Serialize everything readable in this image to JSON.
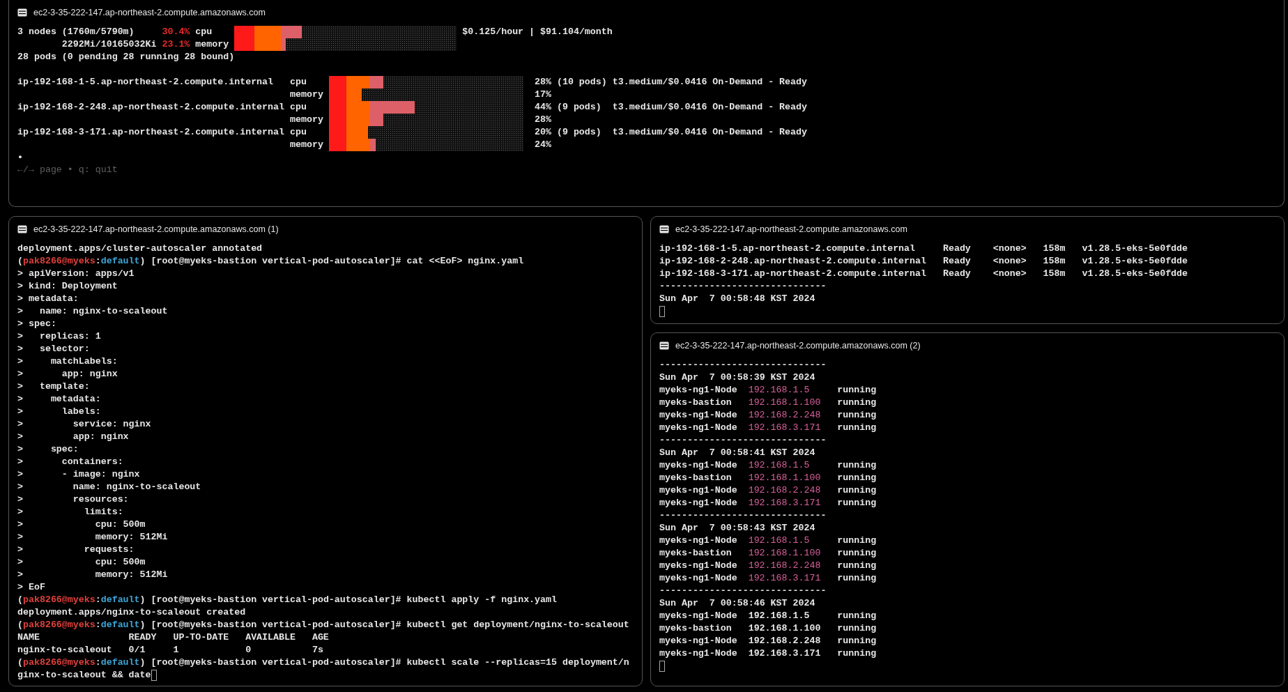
{
  "viewer": {
    "title": "ec2-3-35-222-147.ap-northeast-2.compute.amazonaws.com",
    "summary": [
      {
        "text": "3 nodes (1760m/5790m)",
        "percent": "30.4%",
        "resource": "cpu",
        "level": 0.304
      },
      {
        "text": "2292Mi/10165032Ki",
        "percent": "23.1%",
        "resource": "memory",
        "level": 0.231
      }
    ],
    "cost": "$0.125/hour | $91.104/month",
    "pods": "28 pods (0 pending 28 running 28 bound)",
    "nodes": [
      {
        "name": "ip-192-168-1-5.ap-northeast-2.compute.internal",
        "bars": [
          {
            "resource": "cpu",
            "level": 0.28,
            "percent": "28%"
          },
          {
            "resource": "memory",
            "level": 0.17,
            "percent": "17%"
          }
        ],
        "pods": "(10 pods)",
        "detail": "t3.medium/$0.0416 On-Demand - Ready"
      },
      {
        "name": "ip-192-168-2-248.ap-northeast-2.compute.internal",
        "bars": [
          {
            "resource": "cpu",
            "level": 0.44,
            "percent": "44%"
          },
          {
            "resource": "memory",
            "level": 0.28,
            "percent": "28%"
          }
        ],
        "pods": "(9 pods)",
        "detail": "t3.medium/$0.0416 On-Demand - Ready"
      },
      {
        "name": "ip-192-168-3-171.ap-northeast-2.compute.internal",
        "bars": [
          {
            "resource": "cpu",
            "level": 0.2,
            "percent": "20%"
          },
          {
            "resource": "memory",
            "level": 0.24,
            "percent": "24%"
          }
        ],
        "pods": "(9 pods)",
        "detail": "t3.medium/$0.0416 On-Demand - Ready"
      }
    ],
    "page_dot": "•",
    "help": "←/→ page • q: quit"
  },
  "shell": {
    "title": "ec2-3-35-222-147.ap-northeast-2.compute.amazonaws.com (1)",
    "lines": [
      {
        "text": "deployment.apps/cluster-autoscaler annotated"
      },
      {
        "segments": [
          {
            "kind": "plain",
            "text": "("
          },
          {
            "kind": "user",
            "text": "pak8266@myeks"
          },
          {
            "kind": "plain",
            "text": ":"
          },
          {
            "kind": "context",
            "text": "default"
          },
          {
            "kind": "plain",
            "text": ") [root@myeks-bastion vertical-pod-autoscaler]# cat <<EoF> nginx.yaml"
          }
        ]
      },
      {
        "text": "> apiVersion: apps/v1"
      },
      {
        "text": "> kind: Deployment"
      },
      {
        "text": "> metadata:"
      },
      {
        "text": ">   name: nginx-to-scaleout"
      },
      {
        "text": "> spec:"
      },
      {
        "text": ">   replicas: 1"
      },
      {
        "text": ">   selector:"
      },
      {
        "text": ">     matchLabels:"
      },
      {
        "text": ">       app: nginx"
      },
      {
        "text": ">   template:"
      },
      {
        "text": ">     metadata:"
      },
      {
        "text": ">       labels:"
      },
      {
        "text": ">         service: nginx"
      },
      {
        "text": ">         app: nginx"
      },
      {
        "text": ">     spec:"
      },
      {
        "text": ">       containers:"
      },
      {
        "text": ">       - image: nginx"
      },
      {
        "text": ">         name: nginx-to-scaleout"
      },
      {
        "text": ">         resources:"
      },
      {
        "text": ">           limits:"
      },
      {
        "text": ">             cpu: 500m"
      },
      {
        "text": ">             memory: 512Mi"
      },
      {
        "text": ">           requests:"
      },
      {
        "text": ">             cpu: 500m"
      },
      {
        "text": ">             memory: 512Mi"
      },
      {
        "text": "> EoF"
      },
      {
        "segments": [
          {
            "kind": "plain",
            "text": "("
          },
          {
            "kind": "user",
            "text": "pak8266@myeks"
          },
          {
            "kind": "plain",
            "text": ":"
          },
          {
            "kind": "context",
            "text": "default"
          },
          {
            "kind": "plain",
            "text": ") [root@myeks-bastion vertical-pod-autoscaler]# kubectl apply -f nginx.yaml"
          }
        ]
      },
      {
        "text": "deployment.apps/nginx-to-scaleout created"
      },
      {
        "segments": [
          {
            "kind": "plain",
            "text": "("
          },
          {
            "kind": "user",
            "text": "pak8266@myeks"
          },
          {
            "kind": "plain",
            "text": ":"
          },
          {
            "kind": "context",
            "text": "default"
          },
          {
            "kind": "plain",
            "text": ") [root@myeks-bastion vertical-pod-autoscaler]# kubectl get deployment/nginx-to-scaleout"
          }
        ]
      },
      {
        "text": "NAME                READY   UP-TO-DATE   AVAILABLE   AGE"
      },
      {
        "text": "nginx-to-scaleout   0/1     1            0           7s"
      },
      {
        "segments": [
          {
            "kind": "plain",
            "text": "("
          },
          {
            "kind": "user",
            "text": "pak8266@myeks"
          },
          {
            "kind": "plain",
            "text": ":"
          },
          {
            "kind": "context",
            "text": "default"
          },
          {
            "kind": "plain",
            "text": ") [root@myeks-bastion vertical-pod-autoscaler]# kubectl scale --replicas=15 deployment/n"
          }
        ]
      },
      {
        "text": "ginx-to-scaleout && date",
        "cursor": true
      }
    ]
  },
  "nodes_pane": {
    "title": "ec2-3-35-222-147.ap-northeast-2.compute.amazonaws.com",
    "lines": [
      {
        "text": "ip-192-168-1-5.ap-northeast-2.compute.internal     Ready    <none>   158m   v1.28.5-eks-5e0fdde"
      },
      {
        "text": "ip-192-168-2-248.ap-northeast-2.compute.internal   Ready    <none>   158m   v1.28.5-eks-5e0fdde"
      },
      {
        "text": "ip-192-168-3-171.ap-northeast-2.compute.internal   Ready    <none>   158m   v1.28.5-eks-5e0fdde"
      },
      {
        "text": "------------------------------"
      },
      {
        "text": "Sun Apr  7 00:58:48 KST 2024"
      },
      {
        "cursor": true
      }
    ]
  },
  "watch_pane": {
    "title": "ec2-3-35-222-147.ap-northeast-2.compute.amazonaws.com (2)",
    "blocks": [
      {
        "rule": "------------------------------",
        "timestamp": "Sun Apr  7 00:58:39 KST 2024",
        "highlight": true,
        "rows": [
          {
            "name": "myeks-ng1-Node",
            "ip": "192.168.1.5",
            "state": "running"
          },
          {
            "name": "myeks-bastion",
            "ip": "192.168.1.100",
            "state": "running"
          },
          {
            "name": "myeks-ng1-Node",
            "ip": "192.168.2.248",
            "state": "running"
          },
          {
            "name": "myeks-ng1-Node",
            "ip": "192.168.3.171",
            "state": "running"
          }
        ]
      },
      {
        "rule": "------------------------------",
        "timestamp": "Sun Apr  7 00:58:41 KST 2024",
        "highlight": true,
        "rows": [
          {
            "name": "myeks-ng1-Node",
            "ip": "192.168.1.5",
            "state": "running"
          },
          {
            "name": "myeks-bastion",
            "ip": "192.168.1.100",
            "state": "running"
          },
          {
            "name": "myeks-ng1-Node",
            "ip": "192.168.2.248",
            "state": "running"
          },
          {
            "name": "myeks-ng1-Node",
            "ip": "192.168.3.171",
            "state": "running"
          }
        ]
      },
      {
        "rule": "------------------------------",
        "timestamp": "Sun Apr  7 00:58:43 KST 2024",
        "highlight": true,
        "rows": [
          {
            "name": "myeks-ng1-Node",
            "ip": "192.168.1.5",
            "state": "running"
          },
          {
            "name": "myeks-bastion",
            "ip": "192.168.1.100",
            "state": "running"
          },
          {
            "name": "myeks-ng1-Node",
            "ip": "192.168.2.248",
            "state": "running"
          },
          {
            "name": "myeks-ng1-Node",
            "ip": "192.168.3.171",
            "state": "running"
          }
        ]
      },
      {
        "rule": "------------------------------",
        "timestamp": "Sun Apr  7 00:58:46 KST 2024",
        "highlight": false,
        "rows": [
          {
            "name": "myeks-ng1-Node",
            "ip": "192.168.1.5",
            "state": "running"
          },
          {
            "name": "myeks-bastion",
            "ip": "192.168.1.100",
            "state": "running"
          },
          {
            "name": "myeks-ng1-Node",
            "ip": "192.168.2.248",
            "state": "running"
          },
          {
            "name": "myeks-ng1-Node",
            "ip": "192.168.3.171",
            "state": "running"
          }
        ]
      }
    ],
    "cursor": true
  }
}
